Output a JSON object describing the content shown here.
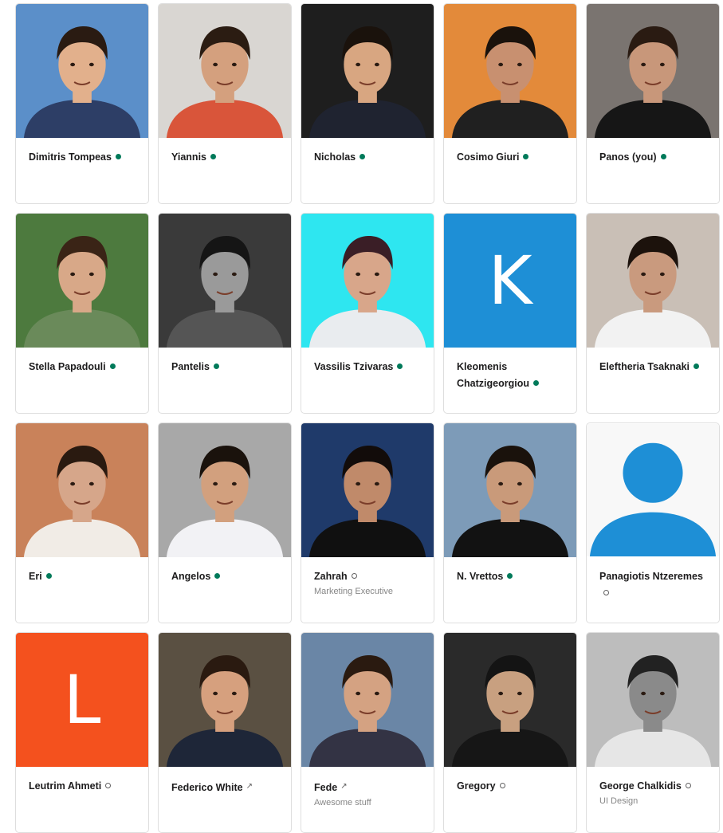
{
  "members": [
    {
      "name": "Dimitris Tompeas",
      "status": "active",
      "title": "",
      "photo": {
        "bg": "#5b8fc9",
        "skin": "#e2b08c",
        "hair": "#2a1b12",
        "shirt": "#2d3e66"
      }
    },
    {
      "name": "Yiannis",
      "status": "active",
      "title": "",
      "photo": {
        "bg": "#d9d6d2",
        "skin": "#d4a07e",
        "hair": "#2b1c12",
        "shirt": "#d9553a"
      }
    },
    {
      "name": "Nicholas",
      "status": "active",
      "title": "",
      "photo": {
        "bg": "#1e1e1e",
        "skin": "#d8a681",
        "hair": "#1a120c",
        "shirt": "#1f2330"
      }
    },
    {
      "name": "Cosimo Giuri",
      "status": "active",
      "title": "",
      "photo": {
        "bg": "#e38a3a",
        "skin": "#c89070",
        "hair": "#1a120c",
        "shirt": "#202020"
      }
    },
    {
      "name": "Panos (you)",
      "status": "active",
      "title": "",
      "photo": {
        "bg": "#7a7470",
        "skin": "#c8977a",
        "hair": "#2a1b12",
        "shirt": "#161616"
      }
    },
    {
      "name": "Stella Papadouli",
      "status": "active",
      "title": "",
      "photo": {
        "bg": "#4d7a3e",
        "skin": "#d8a888",
        "hair": "#3a2416",
        "shirt": "#6a8a5a"
      }
    },
    {
      "name": "Pantelis",
      "status": "active",
      "title": "",
      "photo": {
        "bg": "#3a3a3a",
        "skin": "#9a9a9a",
        "hair": "#151515",
        "shirt": "#555555"
      }
    },
    {
      "name": "Vassilis Tzivaras",
      "status": "active",
      "title": "",
      "photo": {
        "bg": "#2ee6f0",
        "skin": "#d8a68a",
        "hair": "#3a1e26",
        "shirt": "#e9ecef"
      }
    },
    {
      "name": "Kleomenis Chatzigeorgiou",
      "status": "active",
      "title": "",
      "letter": "K",
      "letterBg": "#1e8fd6"
    },
    {
      "name": "Eleftheria Tsaknaki",
      "status": "active",
      "title": "",
      "photo": {
        "bg": "#c9bfb6",
        "skin": "#c99a7e",
        "hair": "#1c120c",
        "shirt": "#f2f2f2"
      }
    },
    {
      "name": "Eri",
      "status": "active",
      "title": "",
      "photo": {
        "bg": "#c9825a",
        "skin": "#d6a68a",
        "hair": "#2a1a10",
        "shirt": "#f1ece6"
      }
    },
    {
      "name": "Angelos",
      "status": "active",
      "title": "",
      "photo": {
        "bg": "#a8a8a8",
        "skin": "#d2a07e",
        "hair": "#1a120c",
        "shirt": "#f2f2f5"
      }
    },
    {
      "name": "Zahrah",
      "status": "away",
      "title": "Marketing Executive",
      "photo": {
        "bg": "#1f3a6a",
        "skin": "#c08a6a",
        "hair": "#120c0a",
        "shirt": "#101010"
      }
    },
    {
      "name": "N. Vrettos",
      "status": "active",
      "title": "",
      "photo": {
        "bg": "#7d9bb8",
        "skin": "#c99a7a",
        "hair": "#1a120c",
        "shirt": "#121212"
      }
    },
    {
      "name": "Panagiotis Ntzeremes",
      "status": "away",
      "title": "",
      "avatar": "default",
      "avatarColor": "#1e8fd6"
    },
    {
      "name": "Leutrim Ahmeti",
      "status": "away",
      "title": "",
      "letter": "L",
      "letterBg": "#f4511e"
    },
    {
      "name": "Federico White",
      "status": "external",
      "title": "",
      "photo": {
        "bg": "#5a5042",
        "skin": "#d6a07e",
        "hair": "#2a1a10",
        "shirt": "#1e2638"
      }
    },
    {
      "name": "Fede",
      "status": "external",
      "title": "Awesome stuff",
      "photo": {
        "bg": "#6a86a6",
        "skin": "#d4a282",
        "hair": "#2a1a10",
        "shirt": "#334"
      }
    },
    {
      "name": "Gregory",
      "status": "away",
      "title": "",
      "photo": {
        "bg": "#2a2a2a",
        "skin": "#c8a080",
        "hair": "#141414",
        "shirt": "#161616"
      }
    },
    {
      "name": "George Chalkidis",
      "status": "away",
      "title": "UI Design",
      "photo": {
        "bg": "#bdbdbd",
        "skin": "#8a8a8a",
        "hair": "#222222",
        "shirt": "#e6e6e6"
      }
    }
  ],
  "icons": {
    "active": "active-status-dot",
    "away": "away-status-ring",
    "external": "external-shared-icon"
  }
}
